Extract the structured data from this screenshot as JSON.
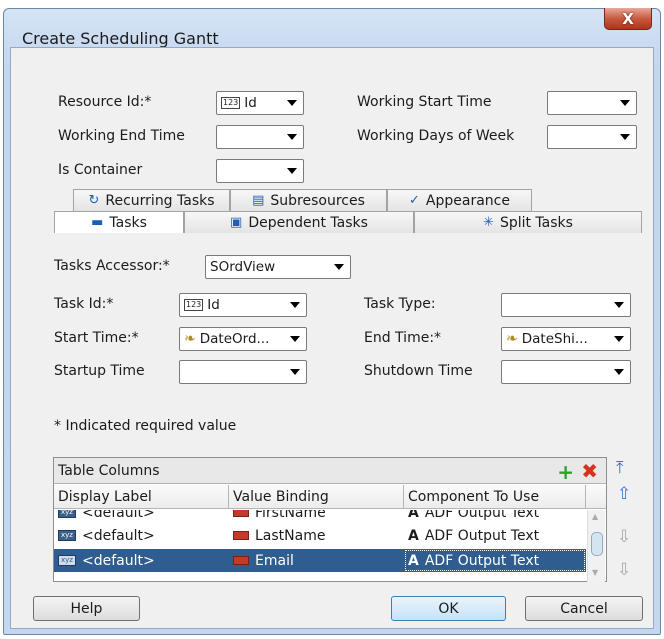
{
  "window": {
    "title": "Create Scheduling Gantt",
    "close_glyph": "X"
  },
  "top_fields": {
    "resource_id": {
      "label": "Resource Id:*",
      "value": "Id",
      "icon": "number-column-icon"
    },
    "working_start_time": {
      "label": "Working Start Time",
      "value": ""
    },
    "working_end_time": {
      "label": "Working End Time",
      "value": ""
    },
    "working_days_of_week": {
      "label": "Working Days of Week",
      "value": ""
    },
    "is_container": {
      "label": "Is Container",
      "value": ""
    }
  },
  "outer_tabs": [
    {
      "label": "Recurring Tasks",
      "icon": "recurring-tasks-icon"
    },
    {
      "label": "Subresources",
      "icon": "subresources-icon"
    },
    {
      "label": "Appearance",
      "icon": "appearance-icon"
    }
  ],
  "inner_tabs": [
    {
      "label": "Tasks",
      "icon": "tasks-icon",
      "active": true
    },
    {
      "label": "Dependent Tasks",
      "icon": "dependent-tasks-icon",
      "active": false
    },
    {
      "label": "Split Tasks",
      "icon": "split-tasks-icon",
      "active": false
    }
  ],
  "tasks_panel": {
    "tasks_accessor": {
      "label": "Tasks Accessor:*",
      "value": "SOrdView"
    },
    "task_id": {
      "label": "Task Id:*",
      "value": "Id"
    },
    "task_type": {
      "label": "Task Type:",
      "value": ""
    },
    "start_time": {
      "label": "Start Time:*",
      "value": "DateOrd..."
    },
    "end_time": {
      "label": "End Time:*",
      "value": "DateShi..."
    },
    "startup_time": {
      "label": "Startup Time",
      "value": ""
    },
    "shutdown_time": {
      "label": "Shutdown Time",
      "value": ""
    }
  },
  "required_note": "* Indicated required value",
  "table_columns": {
    "title": "Table Columns",
    "headers": [
      "Display Label",
      "Value Binding",
      "Component To Use"
    ],
    "rows": [
      {
        "display": "<default>",
        "binding": "FirstName",
        "component": "ADF Output Text",
        "selected": false
      },
      {
        "display": "<default>",
        "binding": "LastName",
        "component": "ADF Output Text",
        "selected": false
      },
      {
        "display": "<default>",
        "binding": "Email",
        "component": "ADF Output Text",
        "selected": true
      }
    ]
  },
  "buttons": {
    "help": "Help",
    "ok": "OK",
    "cancel": "Cancel"
  },
  "colors": {
    "selection": "#2f5d8f",
    "add": "#2ea02e",
    "delete": "#d8321e",
    "move": "#2f78d0"
  }
}
